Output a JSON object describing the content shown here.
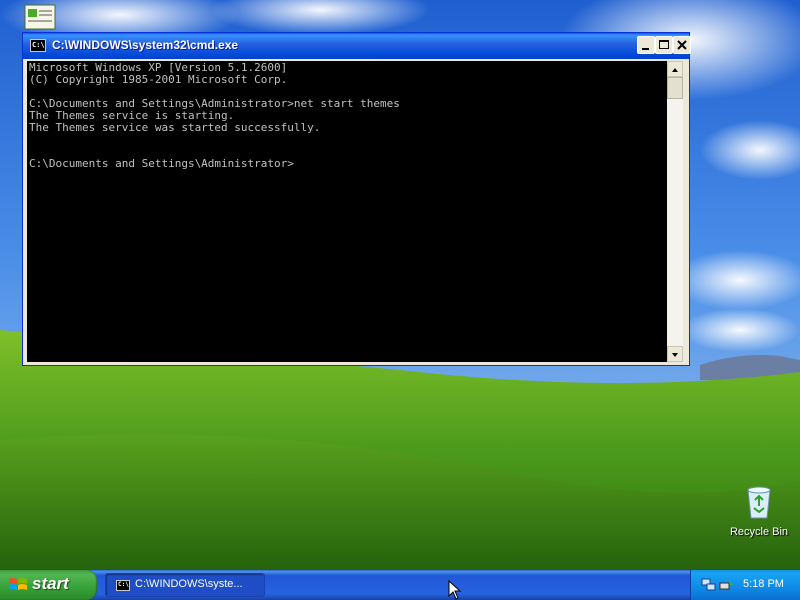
{
  "window": {
    "title": "C:\\WINDOWS\\system32\\cmd.exe",
    "icon_text": "C:\\",
    "console_lines": [
      "Microsoft Windows XP [Version 5.1.2600]",
      "(C) Copyright 1985-2001 Microsoft Corp.",
      "",
      "C:\\Documents and Settings\\Administrator>net start themes",
      "The Themes service is starting.",
      "The Themes service was started successfully.",
      "",
      "",
      "C:\\Documents and Settings\\Administrator>"
    ],
    "console_text_color": "#c0c0c0",
    "console_background": "#000000"
  },
  "desktop": {
    "icons": [
      {
        "label": "Recycle Bin",
        "icon": "recycle-bin-icon"
      }
    ]
  },
  "taskbar": {
    "start_label": "start",
    "tasks": [
      {
        "label": "C:\\WINDOWS\\syste...",
        "icon": "cmd-icon"
      }
    ],
    "tray": {
      "icons": [
        "network-icon",
        "safely-remove-hardware-icon"
      ],
      "clock": "5:18 PM"
    }
  },
  "colors": {
    "titlebar_blue": "#0047d8",
    "taskbar_blue": "#2663e0",
    "start_green": "#37a037",
    "tray_blue": "#0f8ae6"
  }
}
